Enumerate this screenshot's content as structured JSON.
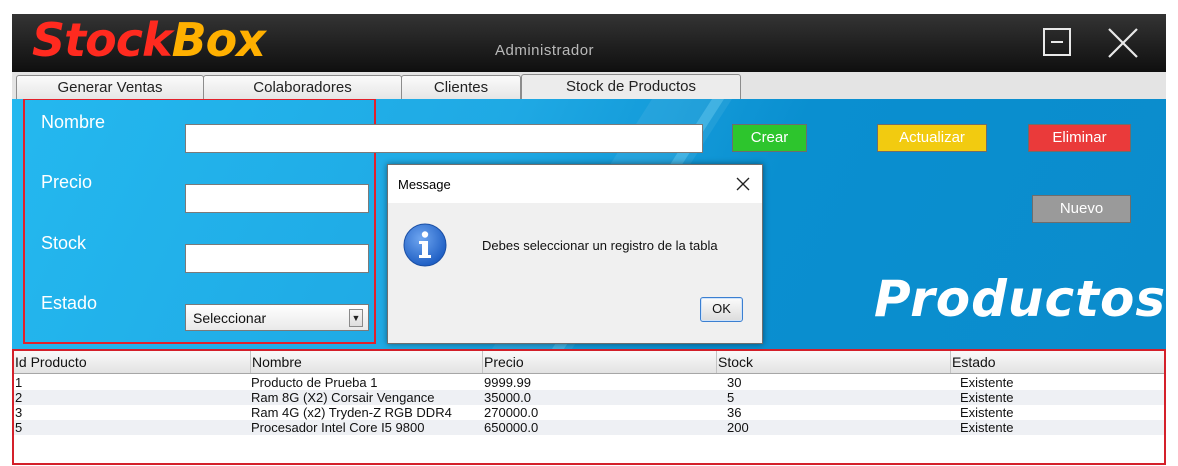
{
  "app": {
    "logo_part1": "Stock",
    "logo_part2": "Box",
    "user_role": "Administrador",
    "icons": [
      "minimize-icon",
      "close-icon"
    ]
  },
  "tabs": [
    {
      "label": "Generar Ventas",
      "active": false
    },
    {
      "label": "Colaboradores",
      "active": false
    },
    {
      "label": "Clientes",
      "active": false
    },
    {
      "label": "Stock de Productos",
      "active": true
    }
  ],
  "form": {
    "nombre_label": "Nombre",
    "precio_label": "Precio",
    "stock_label": "Stock",
    "estado_label": "Estado",
    "nombre_value": "",
    "precio_value": "",
    "stock_value": "",
    "estado_selected": "Seleccionar"
  },
  "buttons": {
    "crear": "Crear",
    "actualizar": "Actualizar",
    "eliminar": "Eliminar",
    "nuevo": "Nuevo"
  },
  "brand": "Productos",
  "colors": {
    "crear": "#2dc52d",
    "actualizar": "#f2cb10",
    "eliminar": "#ea3a3a",
    "nuevo": "#9a9a9a",
    "panel": "#1fa9e4",
    "highlight_border": "#e2202a"
  },
  "table": {
    "columns": [
      "Id Producto",
      "Nombre",
      "Precio",
      "Stock",
      "Estado"
    ],
    "rows": [
      [
        "1",
        "Producto de Prueba 1",
        "9999.99",
        "30",
        "Existente"
      ],
      [
        "2",
        "Ram 8G (X2) Corsair Vengance",
        "35000.0",
        "5",
        "Existente"
      ],
      [
        "3",
        "Ram 4G (x2) Tryden-Z RGB DDR4",
        "270000.0",
        "36",
        "Existente"
      ],
      [
        "5",
        "Procesador Intel Core I5 9800",
        "650000.0",
        "200",
        "Existente"
      ]
    ]
  },
  "dialog": {
    "title": "Message",
    "message": "Debes seleccionar un registro de la tabla",
    "ok_label": "OK",
    "icon": "info-icon"
  }
}
